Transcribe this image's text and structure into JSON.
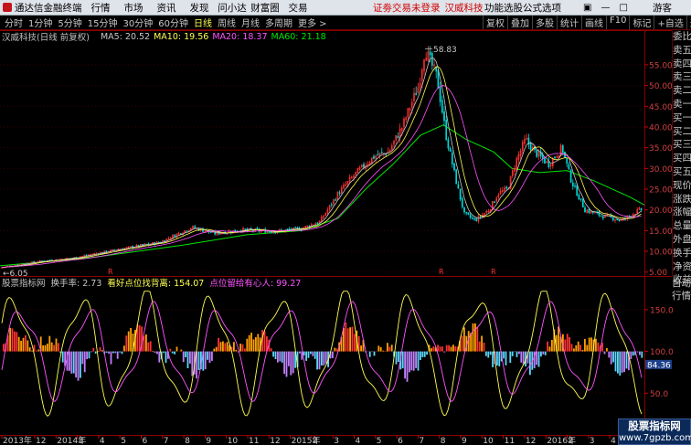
{
  "topbar": {
    "app_title": "通达信金融终端",
    "menus": [
      "行情",
      "市场",
      "资讯",
      "发现",
      "问小达",
      "财富圈",
      "交易"
    ],
    "notice": "证劵交易未登录",
    "stock_name": "汉威科技",
    "right_menus": [
      "功能",
      "选股",
      "公式",
      "选项"
    ],
    "guest": "游客"
  },
  "periods": [
    "分时",
    "1分钟",
    "5分钟",
    "15分钟",
    "30分钟",
    "60分钟",
    "日线",
    "周线",
    "月线",
    "多周期",
    "更多 >"
  ],
  "active_period": "日线",
  "tools": [
    "复权",
    "叠加",
    "多股",
    "统计",
    "画线",
    "F10",
    "标记",
    "+自选",
    "返回"
  ],
  "chart_title": {
    "stock": "汉威科技(日线 前复权)",
    "ma5": "MA5: 20.52",
    "ma10": "MA10: 19.56",
    "ma20": "MA20: 18.37",
    "ma60": "MA60: 21.18"
  },
  "indicator_title": {
    "name": "股票指标网",
    "turnover": "换手率: 2.73",
    "high_label": "看好点位找背离: 154.07",
    "low_label": "点位留给有心人: 99.27"
  },
  "side_panel": [
    "委比",
    "卖五",
    "卖四",
    "卖三",
    "卖二",
    "卖一",
    "买一",
    "买二",
    "买三",
    "买四",
    "买五",
    "现价",
    "涨跌",
    "涨幅",
    "总量",
    "外盘",
    "换手",
    "净资",
    "收益"
  ],
  "side_panel2": [
    "自动",
    "行情"
  ],
  "watermark": {
    "line1": "股票指标网",
    "line2": "www.7gpzb.com"
  },
  "colors": {
    "up": "#ff3232",
    "down": "#00d8d8",
    "ma5": "#c8c8c8",
    "ma10": "#ffff54",
    "ma20": "#ff54ff",
    "ma60": "#00e600",
    "grid": "#8b0000"
  },
  "chart_data": [
    {
      "type": "candlestick",
      "title": "汉威科技(日线 前复权)",
      "x_labels": [
        "2013年",
        "12",
        "2014年",
        "3",
        "4",
        "5",
        "6",
        "7",
        "8",
        "9",
        "10",
        "11",
        "12",
        "2015年",
        "2",
        "3",
        "4",
        "5",
        "6",
        "7",
        "8",
        "9",
        "10",
        "11",
        "12",
        "2016年",
        "2",
        "3",
        "4",
        "5",
        "6"
      ],
      "y_ticks": [
        5,
        10,
        15,
        20,
        25,
        30,
        35,
        40,
        45,
        50,
        55
      ],
      "ylim": [
        4.5,
        60.5
      ],
      "annotations": {
        "high": "58.83",
        "low": "6.05",
        "marker": "R"
      },
      "price_path": [
        [
          0,
          6.05
        ],
        [
          40,
          7.5
        ],
        [
          80,
          8.4
        ],
        [
          130,
          10.5
        ],
        [
          175,
          12.2
        ],
        [
          210,
          15.8
        ],
        [
          235,
          14.3
        ],
        [
          265,
          15.2
        ],
        [
          300,
          14.8
        ],
        [
          330,
          15.5
        ],
        [
          350,
          17.2
        ],
        [
          370,
          24
        ],
        [
          390,
          29
        ],
        [
          410,
          33
        ],
        [
          425,
          34
        ],
        [
          440,
          40
        ],
        [
          458,
          50
        ],
        [
          465,
          58.83
        ],
        [
          478,
          52
        ],
        [
          488,
          38
        ],
        [
          500,
          26
        ],
        [
          508,
          19
        ],
        [
          520,
          17.5
        ],
        [
          535,
          20
        ],
        [
          545,
          24
        ],
        [
          555,
          25
        ],
        [
          565,
          32
        ],
        [
          575,
          37
        ],
        [
          585,
          34
        ],
        [
          600,
          31
        ],
        [
          615,
          35
        ],
        [
          625,
          27
        ],
        [
          640,
          20
        ],
        [
          660,
          18.5
        ],
        [
          680,
          17.5
        ],
        [
          700,
          20
        ]
      ],
      "ma60_path": [
        [
          0,
          6.5
        ],
        [
          100,
          8.5
        ],
        [
          200,
          11.5
        ],
        [
          270,
          14
        ],
        [
          330,
          15
        ],
        [
          370,
          18
        ],
        [
          400,
          25
        ],
        [
          430,
          31
        ],
        [
          460,
          38
        ],
        [
          485,
          40.5
        ],
        [
          510,
          37
        ],
        [
          540,
          34
        ],
        [
          560,
          30
        ],
        [
          590,
          29
        ],
        [
          620,
          29.5
        ],
        [
          650,
          27
        ],
        [
          690,
          23
        ],
        [
          705,
          21.18
        ]
      ]
    },
    {
      "type": "bar",
      "title": "股票指标网",
      "y_ticks": [
        50.0,
        100.0,
        150.0
      ],
      "ylim": [
        0,
        175
      ],
      "current_value_tag": "84.36",
      "series": [
        {
          "name": "看好点位找背离",
          "value": 154.07
        },
        {
          "name": "点位留给有心人",
          "value": 99.27
        }
      ]
    }
  ]
}
